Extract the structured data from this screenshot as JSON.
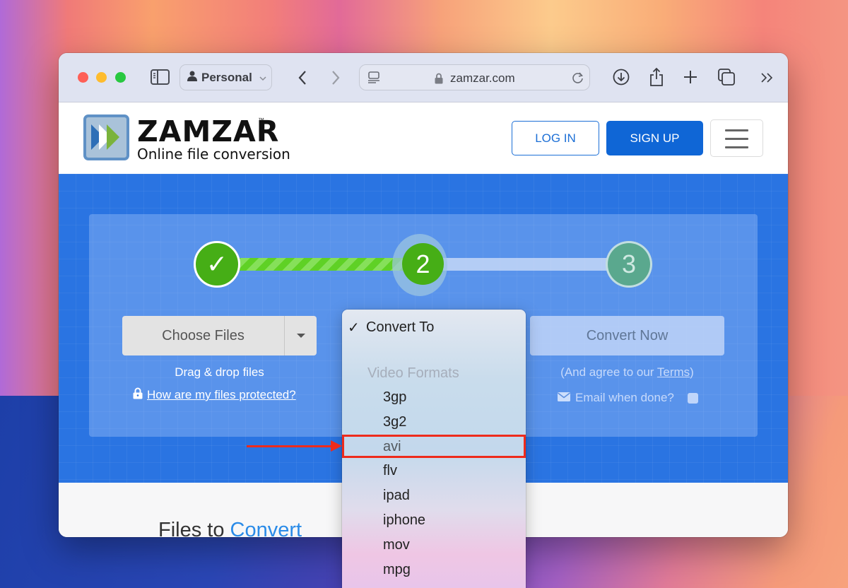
{
  "browser": {
    "profile_label": "Personal",
    "address": "zamzar.com",
    "icons": {
      "sidebar": "sidebar-icon",
      "back": "chevron-left-icon",
      "forward": "chevron-right-icon",
      "reader": "reader-icon",
      "lock": "lock-icon",
      "reload": "reload-icon",
      "downloads": "download-icon",
      "share": "share-icon",
      "new_tab": "plus-icon",
      "tabs": "tab-overview-icon",
      "more": "double-chevron-right-icon"
    }
  },
  "site": {
    "brand": "ZAMZAR",
    "trademark": "™",
    "tagline": "Online file conversion",
    "login_label": "LOG IN",
    "signup_label": "SIGN UP",
    "colors": {
      "primary": "#0f66d6",
      "hero": "#2a74e2",
      "success": "#46ae16",
      "accent_text": "#2a8be8"
    }
  },
  "steps": {
    "step1": "✓",
    "step2": "2",
    "step3": "3",
    "current_step": 2,
    "total_steps": 3
  },
  "upload": {
    "choose_label": "Choose Files",
    "drag_drop": "Drag & drop files",
    "protected_link": "How are my files protected?"
  },
  "convert": {
    "button_label": "Convert Now",
    "agree_prefix": "(And agree to our ",
    "terms_link": "Terms",
    "agree_suffix": ")",
    "email_label": "Email when done?"
  },
  "files_section": {
    "title_plain": "Files to ",
    "title_accent": "Convert"
  },
  "dropdown": {
    "selected_check": "✓",
    "selected_label": "Convert To",
    "group_label": "Video Formats",
    "options": [
      "3gp",
      "3g2",
      "avi",
      "flv",
      "ipad",
      "iphone",
      "mov",
      "mpg"
    ],
    "highlighted": "avi"
  }
}
